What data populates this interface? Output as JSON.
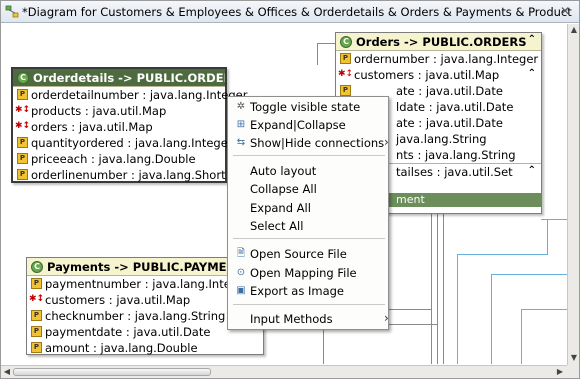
{
  "tab": {
    "title": "*Diagram for Customers & Employees & Offices & Orderdetails & Orders & Payments & Product",
    "close_glyph": "✕",
    "icon": "diagram-icon"
  },
  "tables": {
    "orderdetails": {
      "title": "Orderdetails -> PUBLIC.ORDERDE",
      "rows": [
        {
          "icon": "primary-key-icon",
          "label": "orderdetailnumber : java.lang.Integer"
        },
        {
          "icon": "foreign-key-icon",
          "label": "products : java.util.Map"
        },
        {
          "icon": "foreign-key-icon",
          "label": "orders : java.util.Map"
        },
        {
          "icon": "property-icon",
          "label": "quantityordered : java.lang.Integer"
        },
        {
          "icon": "property-icon",
          "label": "priceeach : java.lang.Double"
        },
        {
          "icon": "property-icon",
          "label": "orderlinenumber : java.lang.Short"
        }
      ]
    },
    "orders": {
      "title": "Orders -> PUBLIC.ORDERS",
      "rows": [
        {
          "icon": "primary-key-icon",
          "label": "ordernumber : java.lang.Integer"
        },
        {
          "icon": "foreign-key-icon",
          "label": "customers : java.util.Map"
        },
        {
          "icon": "property-icon",
          "label": "ate : java.util.Date"
        },
        {
          "icon": "property-icon",
          "label": "ldate : java.util.Date"
        },
        {
          "icon": "property-icon",
          "label": "ate : java.util.Date"
        },
        {
          "icon": "property-icon",
          "label": "java.lang.String"
        },
        {
          "icon": "property-icon",
          "label": "nts : java.lang.String"
        },
        {
          "icon": "property-icon",
          "label": "tailses : java.util.Set"
        }
      ],
      "green_bar": "ment"
    },
    "payments": {
      "title": "Payments -> PUBLIC.PAYMENTS",
      "rows": [
        {
          "icon": "primary-key-icon",
          "label": "paymentnumber : java.lang.Integer"
        },
        {
          "icon": "foreign-key-icon",
          "label": "customers : java.util.Map"
        },
        {
          "icon": "property-icon",
          "label": "checknumber : java.lang.String"
        },
        {
          "icon": "property-icon",
          "label": "paymentdate : java.util.Date"
        },
        {
          "icon": "property-icon",
          "label": "amount : java.lang.Double"
        }
      ]
    }
  },
  "context_menu": {
    "items": [
      {
        "label": "Toggle visible state",
        "icon": "toggle-icon"
      },
      {
        "label": "Expand|Collapse",
        "icon": "expand-collapse-icon"
      },
      {
        "label": "Show|Hide connections",
        "icon": "connections-icon",
        "submenu": true
      },
      {
        "label": "Auto layout",
        "icon": ""
      },
      {
        "label": "Collapse All",
        "icon": ""
      },
      {
        "label": "Expand All",
        "icon": ""
      },
      {
        "label": "Select All",
        "icon": ""
      },
      {
        "label": "Open Source File",
        "icon": "source-file-icon"
      },
      {
        "label": "Open Mapping File",
        "icon": "mapping-file-icon"
      },
      {
        "label": "Export as Image",
        "icon": "export-image-icon"
      },
      {
        "label": "Input Methods",
        "icon": "",
        "submenu": true
      }
    ],
    "submenu_arrow": "›"
  },
  "scroll": {
    "left_arrow": "◀",
    "right_arrow": "▶",
    "up_arrow": "▲",
    "down_arrow": "▼"
  },
  "colors": {
    "table_header": "#f6f3cf",
    "menu_bg": "#fdfdfb",
    "connection_blue": "#66b0d9"
  }
}
